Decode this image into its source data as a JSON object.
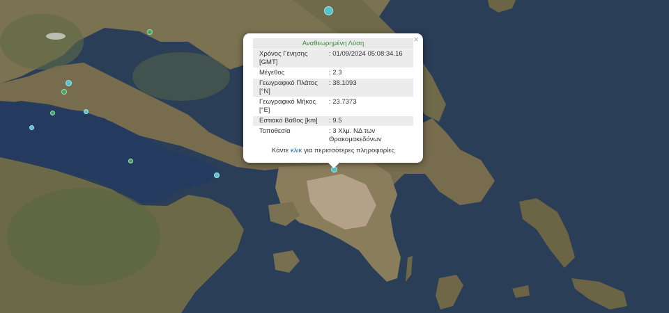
{
  "popup": {
    "title": "Αναθεωρημένη Λύση",
    "close_glyph": "×",
    "rows": [
      {
        "label": "Χρόνος Γένησης [GMT]",
        "value": ": 01/09/2024 05:08:34.16"
      },
      {
        "label": "Μέγεθος",
        "value": ": 2.3"
      },
      {
        "label": "Γεωγραφικό Πλάτος [°N]",
        "value": ": 38.1093"
      },
      {
        "label": "Γεωγραφικό Μήκος [°E]",
        "value": ": 23.7373"
      },
      {
        "label": "Εστιακό Βάθος [km]",
        "value": ": 9.5"
      },
      {
        "label": "Τοποθεσία",
        "value": ": 3 Χλμ. ΝΔ των Θρακομακεδόνων"
      }
    ],
    "footer_before": "Κάντε ",
    "footer_link": "κλικ",
    "footer_after": " για περισσότερες πληροφορίες"
  },
  "colors": {
    "sea_deep": "#2b3e58",
    "sea_gulf": "#243a5e",
    "land": "#7d7355",
    "mountain": "#5d6a44",
    "urban": "#b3a189",
    "marker_cyan": "#4fc4cf",
    "marker_green": "#3fa862",
    "popup_title": "#3a8a3a",
    "link": "#1a63c7"
  },
  "markers": [
    {
      "id": "selected",
      "type": "cyan"
    },
    {
      "id": "north-coast",
      "type": "cyan"
    },
    {
      "id": "gulf-west",
      "type": "cyan"
    },
    {
      "id": "gulf-north-1",
      "type": "cyan"
    },
    {
      "id": "gulf-north-2",
      "type": "green"
    },
    {
      "id": "gulf-north-3",
      "type": "green"
    },
    {
      "id": "gulf-mid",
      "type": "cyan"
    },
    {
      "id": "mountain-north",
      "type": "green"
    },
    {
      "id": "gulf-south",
      "type": "green"
    },
    {
      "id": "gulf-east",
      "type": "cyan"
    }
  ]
}
